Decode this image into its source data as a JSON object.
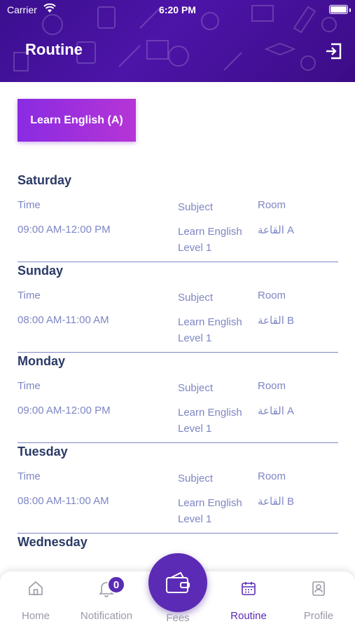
{
  "status": {
    "carrier": "Carrier",
    "time": "6:20 PM"
  },
  "header": {
    "title": "Routine"
  },
  "course_button": "Learn English (A)",
  "columns": {
    "time": "Time",
    "subject": "Subject",
    "room": "Room"
  },
  "days": [
    {
      "name": "Saturday",
      "time": "09:00 AM-12:00 PM",
      "subject_line1": "Learn English",
      "subject_line2": "Level 1",
      "room": "القاعة A"
    },
    {
      "name": "Sunday",
      "time": "08:00 AM-11:00 AM",
      "subject_line1": "Learn English",
      "subject_line2": "Level 1",
      "room": "القاعة B"
    },
    {
      "name": "Monday",
      "time": "09:00 AM-12:00 PM",
      "subject_line1": "Learn English",
      "subject_line2": "Level 1",
      "room": "القاعة A"
    },
    {
      "name": "Tuesday",
      "time": "08:00 AM-11:00 AM",
      "subject_line1": "Learn English",
      "subject_line2": "Level 1",
      "room": "القاعة B"
    },
    {
      "name": "Wednesday"
    }
  ],
  "tabbar": {
    "home": "Home",
    "notification": "Notification",
    "notification_count": "0",
    "fees": "Fees",
    "routine": "Routine",
    "profile": "Profile"
  },
  "colors": {
    "primary": "#5b2bb5",
    "text_dark": "#2b3a66",
    "text_muted": "#7e86c4"
  }
}
